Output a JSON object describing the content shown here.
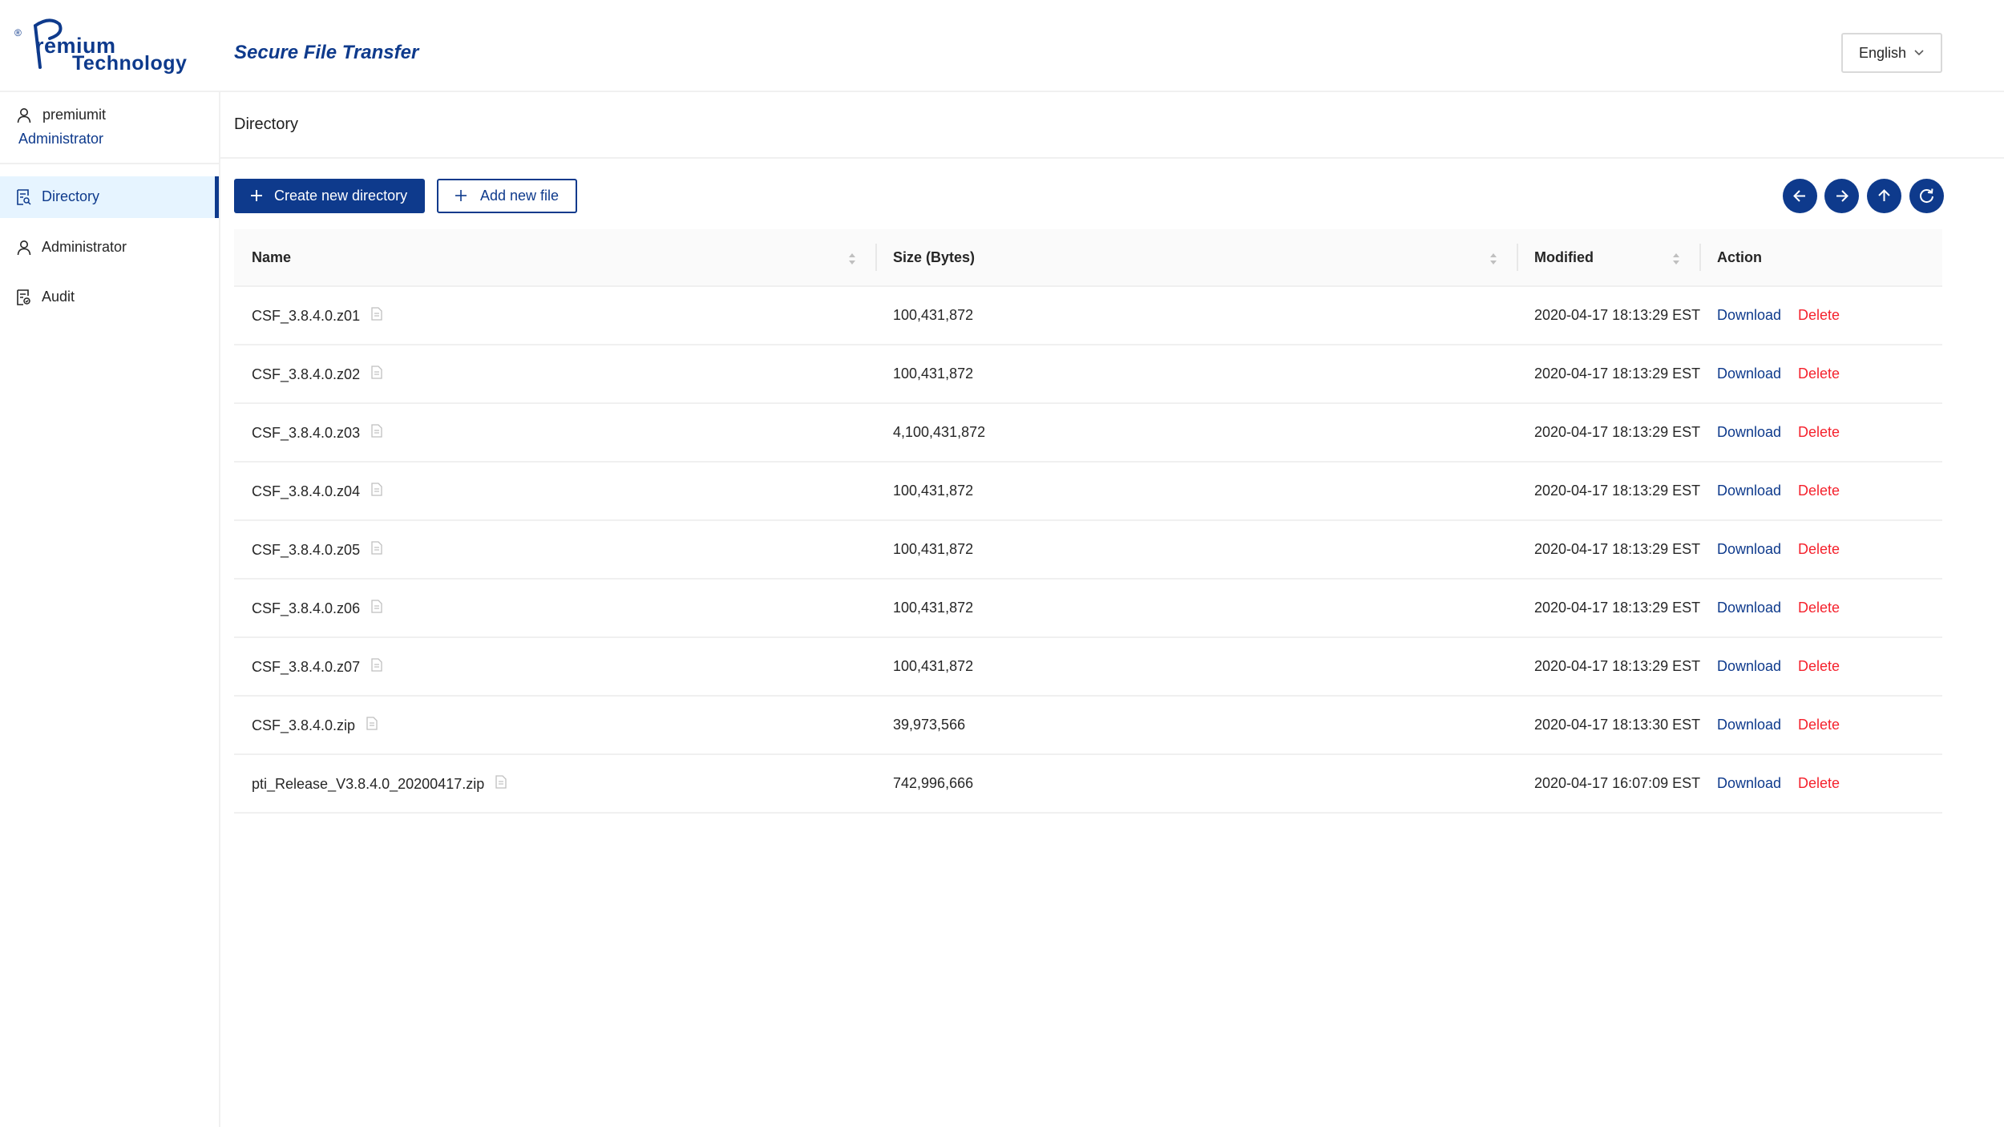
{
  "header": {
    "logo_reg": "®",
    "logo_line1": "remium",
    "logo_line2": "Technology",
    "app_title": "Secure File Transfer",
    "language": "English"
  },
  "sidebar": {
    "user_name": "premiumit",
    "user_role": "Administrator",
    "items": [
      {
        "label": "Directory",
        "icon": "file-search-icon",
        "active": true
      },
      {
        "label": "Administrator",
        "icon": "user-icon",
        "active": false
      },
      {
        "label": "Audit",
        "icon": "audit-icon",
        "active": false
      }
    ]
  },
  "main": {
    "title": "Directory",
    "create_dir_label": "Create new directory",
    "add_file_label": "Add new file",
    "nav_buttons": [
      "arrow-left-icon",
      "arrow-right-icon",
      "arrow-up-icon",
      "reload-icon"
    ]
  },
  "table": {
    "columns": {
      "name": "Name",
      "size": "Size (Bytes)",
      "modified": "Modified",
      "action": "Action"
    },
    "download_label": "Download",
    "delete_label": "Delete",
    "rows": [
      {
        "name": "CSF_3.8.4.0.z01",
        "size": "100,431,872",
        "modified": "2020-04-17 18:13:29 EST"
      },
      {
        "name": "CSF_3.8.4.0.z02",
        "size": "100,431,872",
        "modified": "2020-04-17 18:13:29 EST"
      },
      {
        "name": "CSF_3.8.4.0.z03",
        "size": "4,100,431,872",
        "modified": "2020-04-17 18:13:29 EST"
      },
      {
        "name": "CSF_3.8.4.0.z04",
        "size": "100,431,872",
        "modified": "2020-04-17 18:13:29 EST"
      },
      {
        "name": "CSF_3.8.4.0.z05",
        "size": "100,431,872",
        "modified": "2020-04-17 18:13:29 EST"
      },
      {
        "name": "CSF_3.8.4.0.z06",
        "size": "100,431,872",
        "modified": "2020-04-17 18:13:29 EST"
      },
      {
        "name": "CSF_3.8.4.0.z07",
        "size": "100,431,872",
        "modified": "2020-04-17 18:13:29 EST"
      },
      {
        "name": "CSF_3.8.4.0.zip",
        "size": "39,973,566",
        "modified": "2020-04-17 18:13:30 EST"
      },
      {
        "name": "pti_Release_V3.8.4.0_20200417.zip",
        "size": "742,996,666",
        "modified": "2020-04-17 16:07:09 EST"
      }
    ]
  },
  "colors": {
    "brand": "#0e3a8c",
    "danger": "#f5222d",
    "active_bg": "#e6f4ff"
  }
}
